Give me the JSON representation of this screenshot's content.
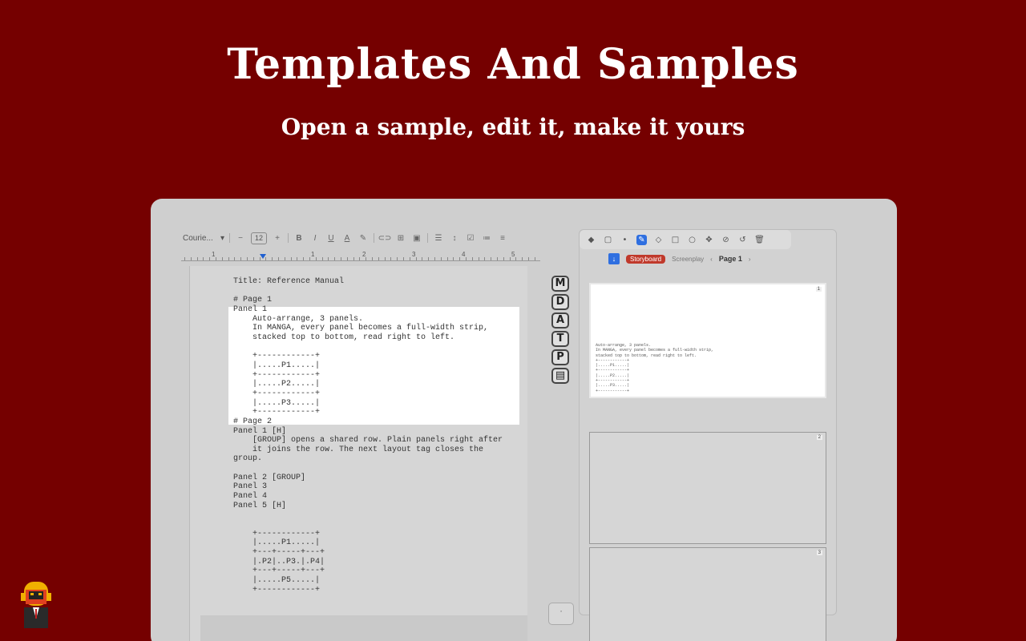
{
  "hero": {
    "title": "Templates And Samples",
    "subtitle": "Open a sample, edit it, make it yours"
  },
  "toolbar": {
    "font": "Courie...",
    "font_size": "12",
    "minus": "−",
    "plus": "+",
    "bold": "B",
    "italic": "I",
    "underline": "U",
    "text_color": "A"
  },
  "ruler": {
    "numbers": [
      "1",
      "1",
      "2",
      "3",
      "4",
      "5"
    ]
  },
  "document": {
    "lines": [
      "Title: Reference Manual",
      "",
      "# Page 1",
      "Panel 1",
      "    Auto-arrange, 3 panels.",
      "    In MANGA, every panel becomes a full-width strip,",
      "    stacked top to bottom, read right to left.",
      "",
      "    +------------+",
      "    |.....P1.....|",
      "    +------------+",
      "    |.....P2.....|",
      "    +------------+",
      "    |.....P3.....|",
      "    +------------+",
      "# Page 2",
      "Panel 1 [H]",
      "    [GROUP] opens a shared row. Plain panels right after",
      "    it joins the row. The next layout tag closes the",
      "group.",
      "",
      "Panel 2 [GROUP]",
      "Panel 3",
      "Panel 4",
      "Panel 5 [H]",
      "",
      "",
      "    +------------+",
      "    |.....P1.....|",
      "    +---+-----+---+",
      "    |.P2|..P3.|.P4|",
      "    +---+-----+---+",
      "    |.....P5.....|",
      "    +------------+"
    ]
  },
  "modes": [
    "M",
    "D",
    "A",
    "T",
    "P",
    "▤"
  ],
  "preview": {
    "mode_active": "Storyboard",
    "mode_other": "Screenplay",
    "page_label": "Page 1",
    "prev": "‹",
    "next": "›",
    "cards": [
      {
        "num": "1",
        "text": "Auto-arrange, 3 panels.\nIn MANGA, every panel becomes a full-width strip,\nstacked top to bottom, read right to left.\n+------------+\n|.....P1.....|\n+------------+\n|.....P2.....|\n+------------+\n|.....P3.....|\n+------------+"
      },
      {
        "num": "2",
        "text": ""
      },
      {
        "num": "3",
        "text": ""
      }
    ]
  },
  "mini_button": "·"
}
